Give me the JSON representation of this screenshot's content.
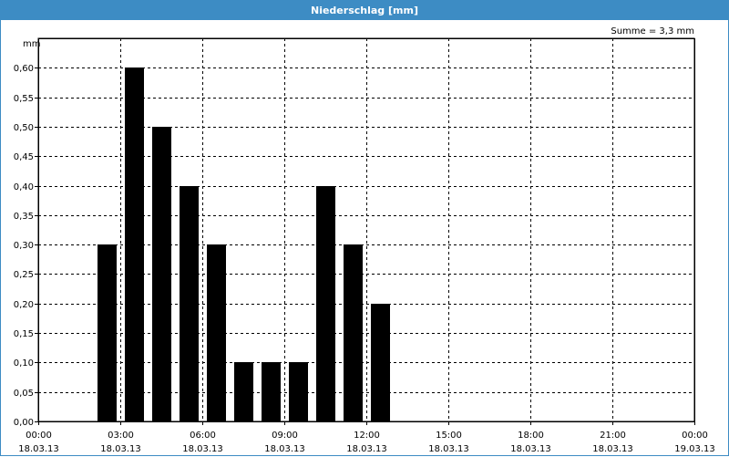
{
  "window": {
    "title": "Niederschlag [mm]"
  },
  "chart_data": {
    "type": "bar",
    "title": "Niederschlag [mm]",
    "ylabel": "mm",
    "summary": "Summe = 3,3 mm",
    "ylim": [
      0,
      0.65
    ],
    "y_ticks": [
      "0,00",
      "0,05",
      "0,10",
      "0,15",
      "0,20",
      "0,25",
      "0,30",
      "0,35",
      "0,40",
      "0,45",
      "0,50",
      "0,55",
      "0,60"
    ],
    "x_range_hours": [
      0,
      24
    ],
    "x_ticks": [
      {
        "time": "00:00",
        "date": "18.03.13"
      },
      {
        "time": "03:00",
        "date": "18.03.13"
      },
      {
        "time": "06:00",
        "date": "18.03.13"
      },
      {
        "time": "09:00",
        "date": "18.03.13"
      },
      {
        "time": "12:00",
        "date": "18.03.13"
      },
      {
        "time": "15:00",
        "date": "18.03.13"
      },
      {
        "time": "18:00",
        "date": "18.03.13"
      },
      {
        "time": "21:00",
        "date": "18.03.13"
      },
      {
        "time": "00:00",
        "date": "19.03.13"
      }
    ],
    "bars": [
      {
        "x": "02:00-03:00",
        "value": 0.3
      },
      {
        "x": "03:00-04:00",
        "value": 0.6
      },
      {
        "x": "04:00-05:00",
        "value": 0.5
      },
      {
        "x": "05:00-06:00",
        "value": 0.4
      },
      {
        "x": "06:00-07:00",
        "value": 0.3
      },
      {
        "x": "07:00-08:00",
        "value": 0.1
      },
      {
        "x": "08:00-09:00",
        "value": 0.1
      },
      {
        "x": "09:00-10:00",
        "value": 0.1
      },
      {
        "x": "10:00-11:00",
        "value": 0.4
      },
      {
        "x": "11:00-12:00",
        "value": 0.3
      },
      {
        "x": "12:00-13:00",
        "value": 0.2
      }
    ],
    "bar_color": "#000000",
    "grid": true
  }
}
